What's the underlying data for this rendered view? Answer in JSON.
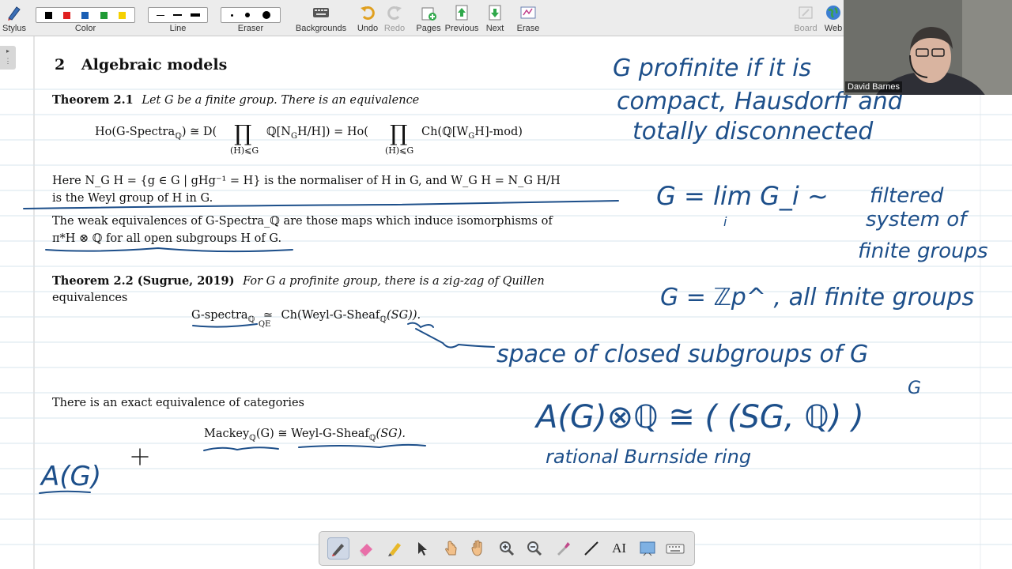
{
  "toolbar": {
    "stylus": "Stylus",
    "color": "Color",
    "line": "Line",
    "eraser": "Eraser",
    "backgrounds": "Backgrounds",
    "undo": "Undo",
    "redo": "Redo",
    "pages": "Pages",
    "previous": "Previous",
    "next": "Next",
    "erase": "Erase",
    "board": "Board",
    "web": "Web",
    "swatch_colors": [
      "#000000",
      "#e02020",
      "#1a5fb4",
      "#1f9a35",
      "#f5d000"
    ]
  },
  "document": {
    "section_number": "2",
    "section_title": "Algebraic models",
    "thm21_label": "Theorem 2.1",
    "thm21_text": "Let G be a finite group. There is an equivalence",
    "thm21_eq": "Ho(G-Spectra",
    "thm21_eq_sub": "ℚ",
    "thm21_eq_mid": ") ≅ D(",
    "thm21_prod": "∏",
    "thm21_prod_index": "(H)⩽G",
    "thm21_eq_term1": "ℚ[N",
    "thm21_eq_term1b": "G",
    "thm21_eq_term1c": "H/H]) = Ho(",
    "thm21_eq_term2": "Ch(ℚ[W",
    "thm21_eq_term2b": "G",
    "thm21_eq_term2c": "H]-mod)",
    "normaliser_line1": "Here N_G H = {g ∈ G | gHg⁻¹ = H} is the normaliser of H in G, and W_G H = N_G H/H",
    "normaliser_line2": "is the Weyl group of H in G.",
    "weak_line1": "The weak equivalences of G-Spectra_ℚ are those maps which induce isomorphisms of",
    "weak_line2": "π*H ⊗ ℚ for all open subgroups H of G.",
    "thm22_label": "Theorem 2.2 (Sugrue, 2019)",
    "thm22_text1": "For G a profinite group, there is a zig-zag of Quillen",
    "thm22_text2": "equivalences",
    "thm22_eq_left": "G-spectra",
    "thm22_eq_left_sub": "ℚ",
    "thm22_eq_rel": "≃",
    "thm22_eq_rel_sub": "QE",
    "thm22_eq_right": "Ch(Weyl-G-Sheaf",
    "thm22_eq_right_sub": "ℚ",
    "thm22_eq_right_tail": "(SG)).",
    "exact_text": "There is an exact equivalence of categories",
    "mackey_left": "Mackey",
    "mackey_left_sub": "ℚ",
    "mackey_left_tail": "(G) ≅ Weyl-G-Sheaf",
    "mackey_right_sub": "ℚ",
    "mackey_right_tail": "(SG)."
  },
  "handwriting": {
    "note1_line1": "G profinite if it is",
    "note1_line2": "compact, Hausdorff and",
    "note1_line3": "totally disconnected",
    "note2_main": "G = lim G_i ~",
    "note2_sub": "i",
    "note2_line1": "filtered",
    "note2_line2": "system of",
    "note2_line3": "finite groups",
    "note3": "G = ℤp^ , all finite groups",
    "note4": "space of closed subgroups of G",
    "note5": "A(G)⊗ℚ ≅ ( (SG, ℚ) )",
    "note5_sup": "G",
    "note6": "rational Burnside ring",
    "note7": "A(G)",
    "ink_color": "#1d4f8a"
  },
  "video": {
    "participant_name": "David Barnes"
  },
  "side_tab": {
    "glyph": "▸"
  },
  "bottom_toolbar": {
    "text_tool": "AI"
  }
}
